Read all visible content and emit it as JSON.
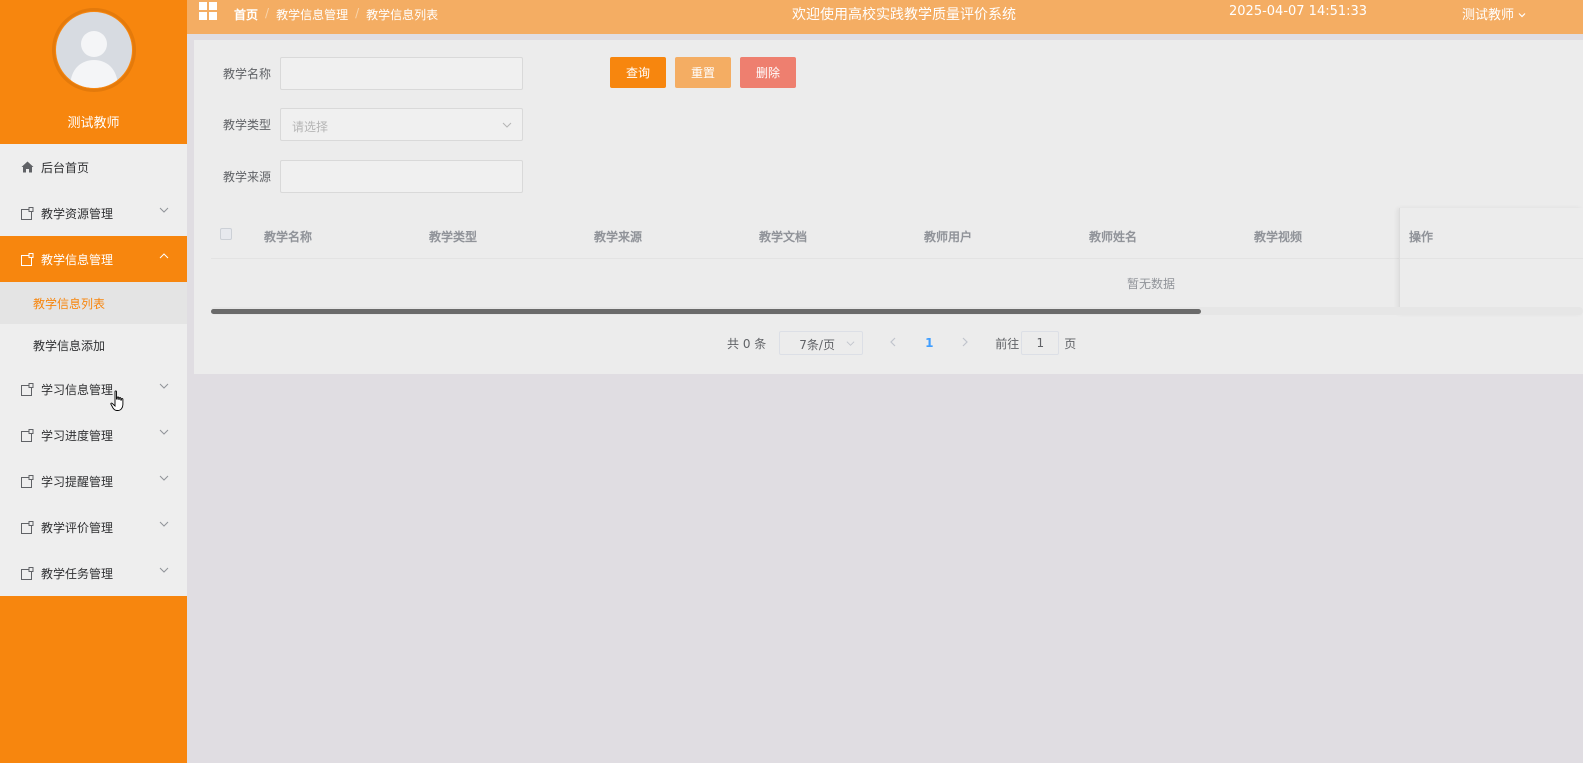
{
  "profile": {
    "name": "测试教师"
  },
  "menu": {
    "home": "后台首页",
    "items": [
      {
        "label": "教学资源管理"
      },
      {
        "label": "教学信息管理"
      },
      {
        "label": "学习信息管理"
      },
      {
        "label": "学习进度管理"
      },
      {
        "label": "学习提醒管理"
      },
      {
        "label": "教学评价管理"
      },
      {
        "label": "教学任务管理"
      }
    ],
    "sub": [
      "教学信息列表",
      "教学信息添加"
    ]
  },
  "topbar": {
    "breadcrumb": [
      "首页",
      "教学信息管理",
      "教学信息列表"
    ],
    "separator": "/",
    "title": "欢迎使用高校实践教学质量评价系统",
    "datetime": "2025-04-07 14:51:33",
    "user": "测试教师"
  },
  "search": {
    "name_label": "教学名称",
    "type_label": "教学类型",
    "type_placeholder": "请选择",
    "source_label": "教学来源",
    "query": "查询",
    "reset": "重置",
    "delete": "删除"
  },
  "table": {
    "columns": [
      "教学名称",
      "教学类型",
      "教学来源",
      "教学文档",
      "教师用户",
      "教师姓名",
      "教学视频"
    ],
    "actions": "操作",
    "empty": "暂无数据"
  },
  "pagination": {
    "total": "共 0 条",
    "page_size": "7条/页",
    "current": "1",
    "goto_label": "前往",
    "goto_value": "1",
    "unit": "页"
  },
  "colors": {
    "accent": "#f7860e",
    "topbar": "#f4ad63",
    "danger": "#ee7f6f"
  }
}
